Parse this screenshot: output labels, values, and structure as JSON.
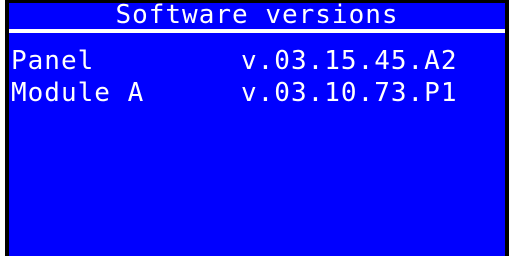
{
  "title": "Software versions",
  "rows": [
    {
      "label": "Panel",
      "value": "v.03.15.45.A2"
    },
    {
      "label": "Module A",
      "value": "v.03.10.73.P1"
    }
  ],
  "colors": {
    "background": "#0000ff",
    "text": "#ffffff",
    "frame": "#000000"
  }
}
